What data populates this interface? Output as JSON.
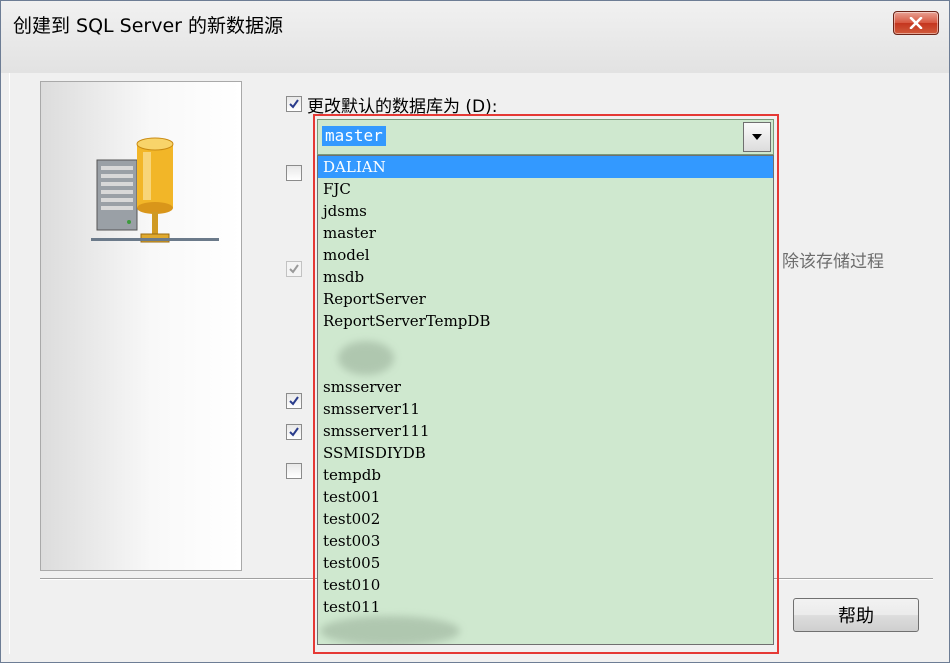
{
  "window": {
    "title": "创建到 SQL Server 的新数据源"
  },
  "checkboxes": {
    "change_default_db": {
      "label": "更改默认的数据库为 (D):",
      "checked": true
    },
    "cb2": {
      "checked": false
    },
    "cb3_disabled": {
      "checked": true
    },
    "cb4": {
      "checked": true
    },
    "cb5": {
      "checked": true
    },
    "cb6": {
      "checked": false
    }
  },
  "partial_text": "除该存储过程",
  "combo": {
    "value": "master"
  },
  "dropdown": {
    "items": [
      "DALIAN",
      "FJC",
      "jdsms",
      "master",
      "model",
      "msdb",
      "ReportServer",
      "ReportServerTempDB",
      "",
      "",
      "smsserver",
      "smsserver11",
      "smsserver111",
      "SSMISDIYDB",
      "tempdb",
      "test001",
      "test002",
      "test003",
      "test005",
      "test010",
      "test011",
      ""
    ],
    "selected_index": 0
  },
  "buttons": {
    "help": "帮助"
  },
  "colors": {
    "dropdown_bg": "#cfe8cf",
    "selection": "#3399ff",
    "highlight_outline": "#e53935"
  }
}
